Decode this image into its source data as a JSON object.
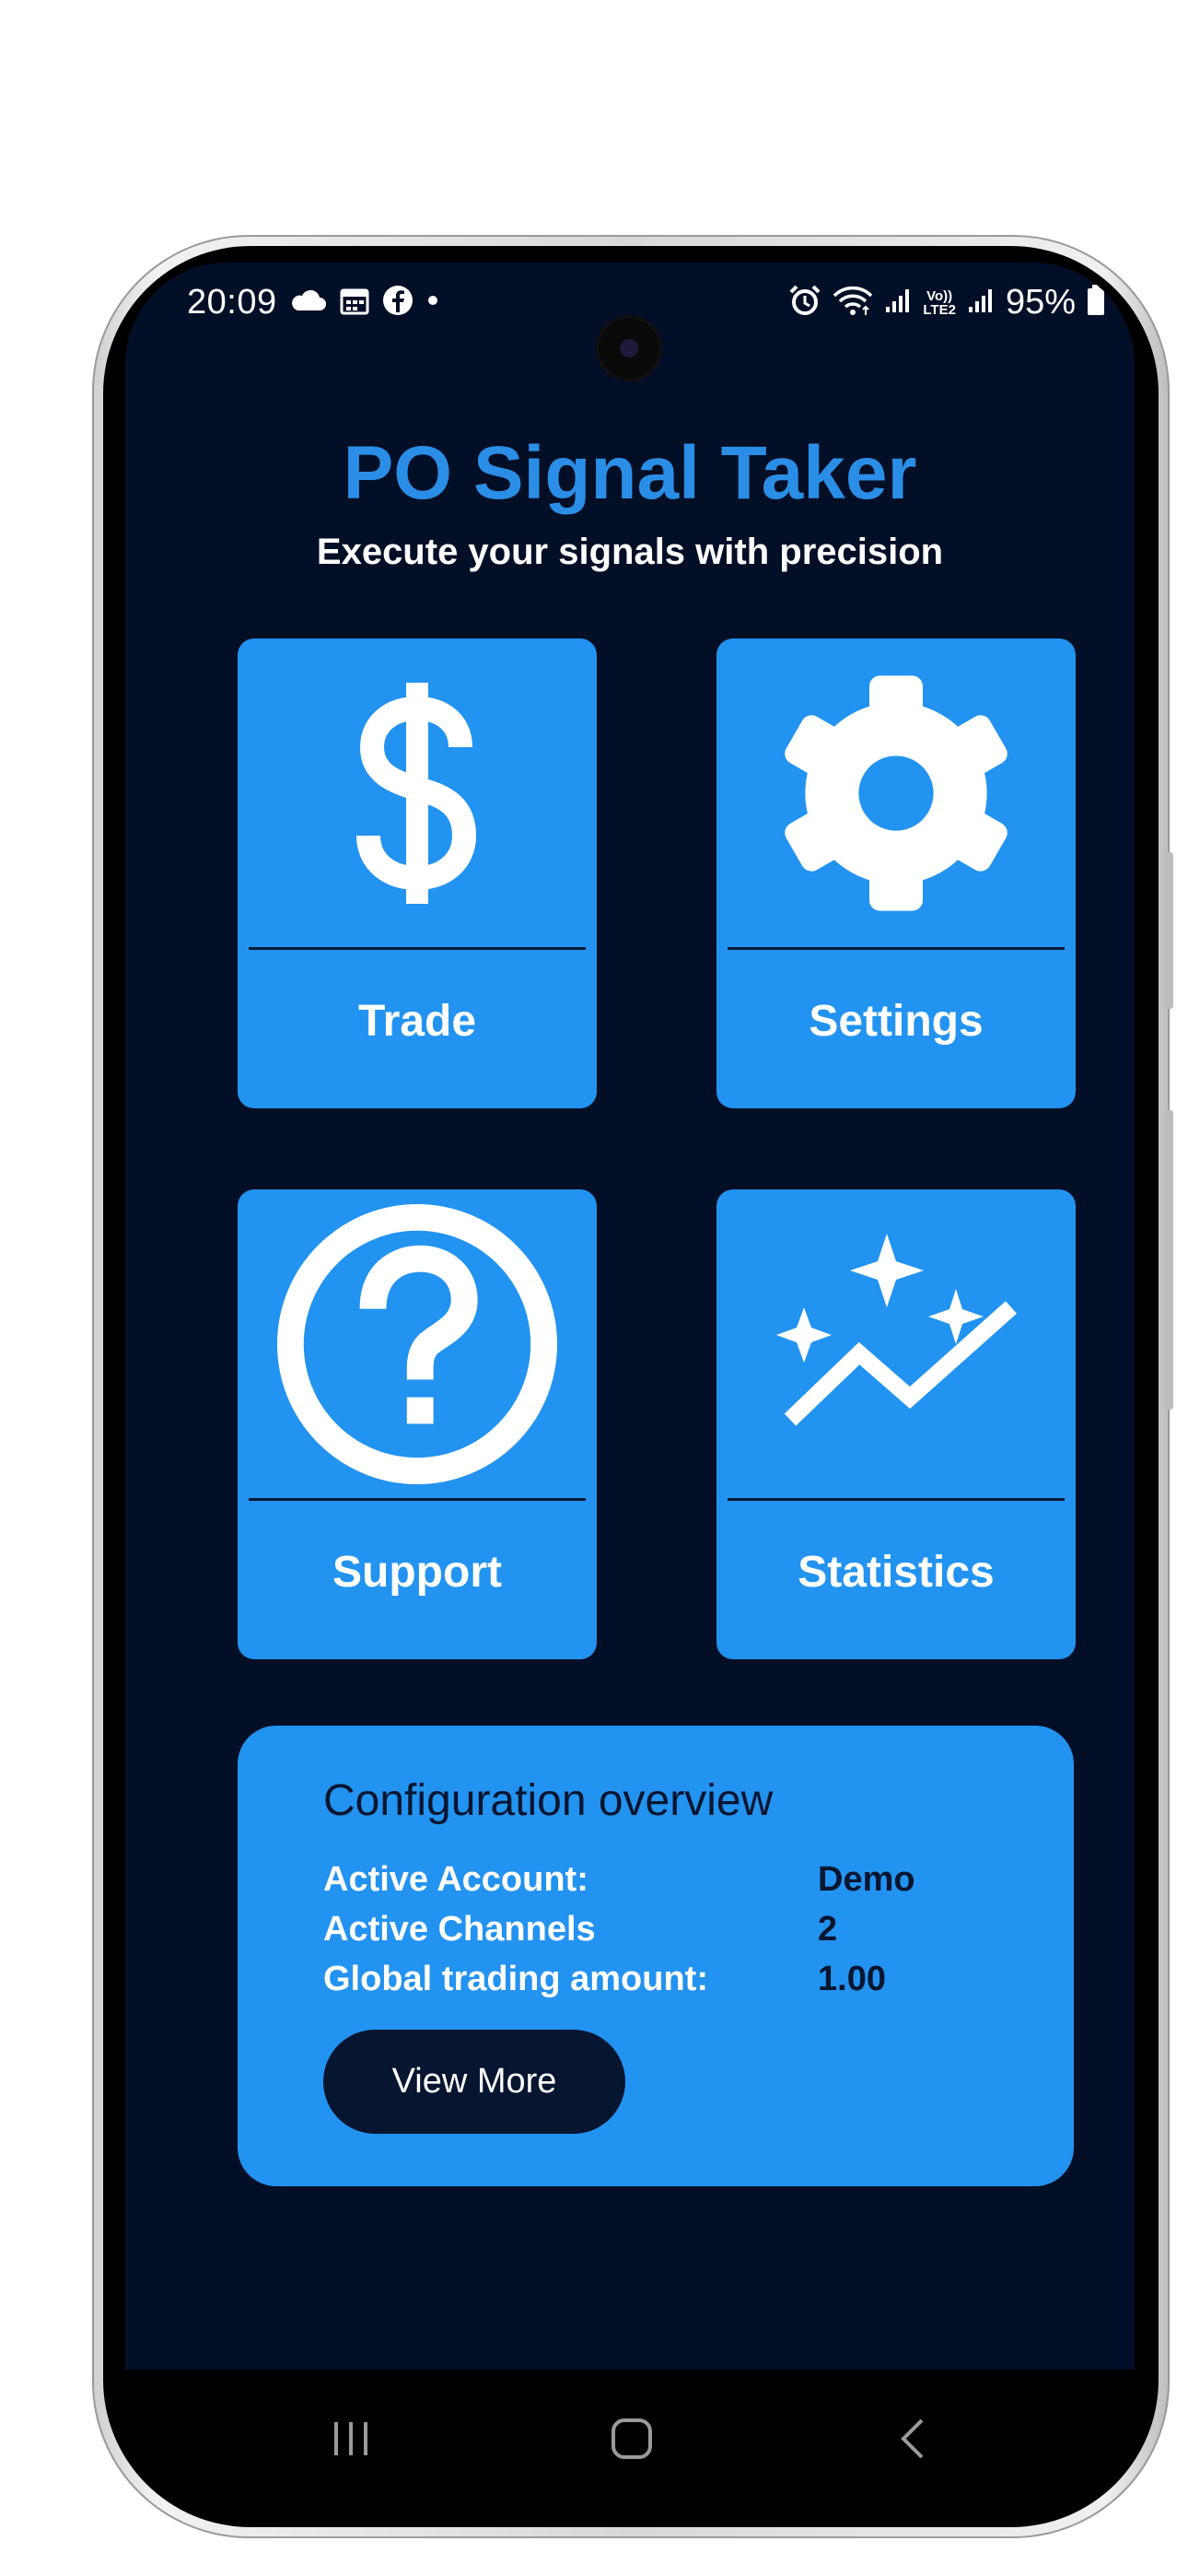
{
  "status_bar": {
    "time": "20:09",
    "battery": "95%",
    "left_icons": [
      "cloud-icon",
      "calendar-icon",
      "facebook-icon",
      "dot-icon"
    ],
    "right_icons": [
      "alarm-icon",
      "wifi-icon",
      "signal-icon",
      "volte-icon",
      "signal-icon-2",
      "battery-icon"
    ],
    "volte_label": "Vo))\nLTE2"
  },
  "app": {
    "title": "PO Signal Taker",
    "subtitle": "Execute your signals with precision"
  },
  "tiles": [
    {
      "label": "Trade",
      "icon": "dollar-icon"
    },
    {
      "label": "Settings",
      "icon": "gear-icon"
    },
    {
      "label": "Support",
      "icon": "question-circle-icon"
    },
    {
      "label": "Statistics",
      "icon": "sparkle-chart-icon"
    }
  ],
  "config": {
    "title": "Configuration overview",
    "rows": [
      {
        "key": "Active Account:",
        "value": "Demo"
      },
      {
        "key": "Active Channels",
        "value": "2"
      },
      {
        "key": "Global trading amount:",
        "value": "1.00"
      }
    ],
    "button_label": "View More"
  },
  "nav": {
    "buttons": [
      "recent-apps-icon",
      "home-icon",
      "back-icon"
    ]
  },
  "colors": {
    "background": "#030f27",
    "accent": "#2293f0",
    "title": "#2b8ee6",
    "dark_text": "#061530"
  }
}
